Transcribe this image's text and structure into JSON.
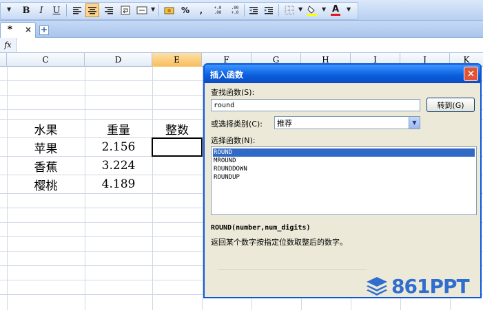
{
  "toolbar": {
    "bold": "B",
    "italic": "I",
    "underline": "U",
    "percent": "%",
    "comma": ",",
    "inc_decimal": "+.0 .00",
    "dec_decimal": ".00 +.0",
    "font_color_letter": "A"
  },
  "tabs": {
    "active_label": "*",
    "close": "×",
    "add": "+"
  },
  "formula_bar": {
    "fx": "fx",
    "value": ""
  },
  "columns": [
    "C",
    "D",
    "E",
    "F",
    "G",
    "H",
    "I",
    "J",
    "K"
  ],
  "selected_column": "E",
  "sheet": {
    "headers": {
      "c": "水果",
      "d": "重量",
      "e": "整数"
    },
    "rows": [
      {
        "c": "苹果",
        "d": "2.156"
      },
      {
        "c": "香蕉",
        "d": "3.224"
      },
      {
        "c": "樱桃",
        "d": "4.189"
      }
    ]
  },
  "dialog": {
    "title": "插入函数",
    "search_label": "查找函数(S):",
    "search_value": "round",
    "goto_button": "转到(G)",
    "category_label": "或选择类别(C):",
    "category_value": "推荐",
    "select_label": "选择函数(N):",
    "functions": [
      "ROUND",
      "MROUND",
      "ROUNDDOWN",
      "ROUNDUP"
    ],
    "selected_index": 0,
    "signature": "ROUND(number,num_digits)",
    "description": "返回某个数字按指定位数取整后的数字。"
  },
  "watermark": {
    "text": "861PPT"
  },
  "colors": {
    "accent": "#0a5ddd",
    "selected_item": "#316ac5",
    "watermark": "#2f6ecf"
  }
}
